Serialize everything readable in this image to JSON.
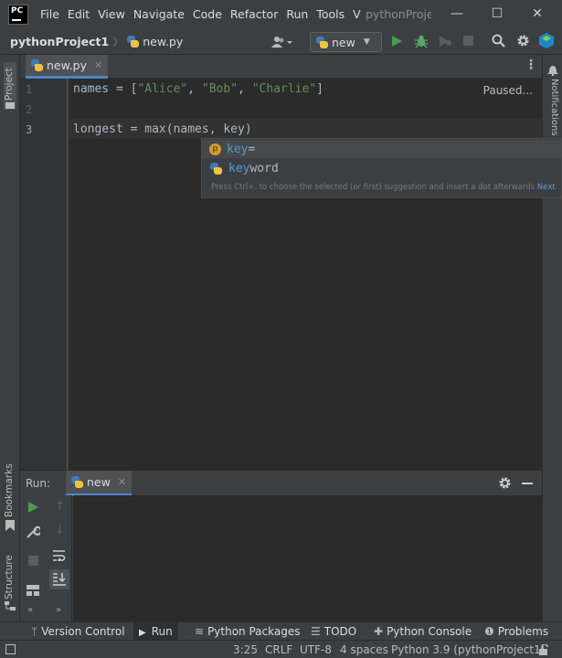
{
  "menu": [
    "File",
    "Edit",
    "View",
    "Navigate",
    "Code",
    "Refactor",
    "Run",
    "Tools",
    "V"
  ],
  "window": {
    "title": "pythonProjec",
    "minimize": "—",
    "maximize": "☐",
    "close": "✕"
  },
  "breadcrumb": {
    "project": "pythonProject1",
    "file": "new.py"
  },
  "run_config": {
    "label": "new"
  },
  "left_strip": {
    "project": "Project",
    "bookmarks": "Bookmarks",
    "structure": "Structure"
  },
  "right_strip": {
    "notifications": "Notifications"
  },
  "editor": {
    "tab_label": "new.py",
    "status": "Paused...",
    "line_numbers": [
      "1",
      "2",
      "3"
    ],
    "lines": {
      "l1_a": "names = [",
      "l1_s1": "\"Alice\"",
      "l1_c1": ", ",
      "l1_s2": "\"Bob\"",
      "l1_c2": ", ",
      "l1_s3": "\"Charlie\"",
      "l1_end": "]",
      "l3": "longest = max(names, key)"
    }
  },
  "completion": {
    "items": [
      {
        "badge": "p",
        "match": "key",
        "rest": "="
      },
      {
        "match": "key",
        "rest": "word"
      }
    ],
    "hint": "Press Ctrl+. to choose the selected (or first) suggestion and insert a dot afterwards",
    "hint_link": "Next"
  },
  "run_panel": {
    "title": "Run:",
    "tab": "new"
  },
  "bottom_tools": [
    "Version Control",
    "Run",
    "Python Packages",
    "TODO",
    "Python Console",
    "Problems"
  ],
  "status_bar": {
    "position": "3:25",
    "line_ending": "CRLF",
    "encoding": "UTF-8",
    "indent": "4 spaces",
    "interpreter": "Python 3.9 (pythonProject1)"
  },
  "colors": {
    "accent": "#4a88c7",
    "string": "#6a8759",
    "run": "#499c54",
    "debug": "#e0c234"
  }
}
